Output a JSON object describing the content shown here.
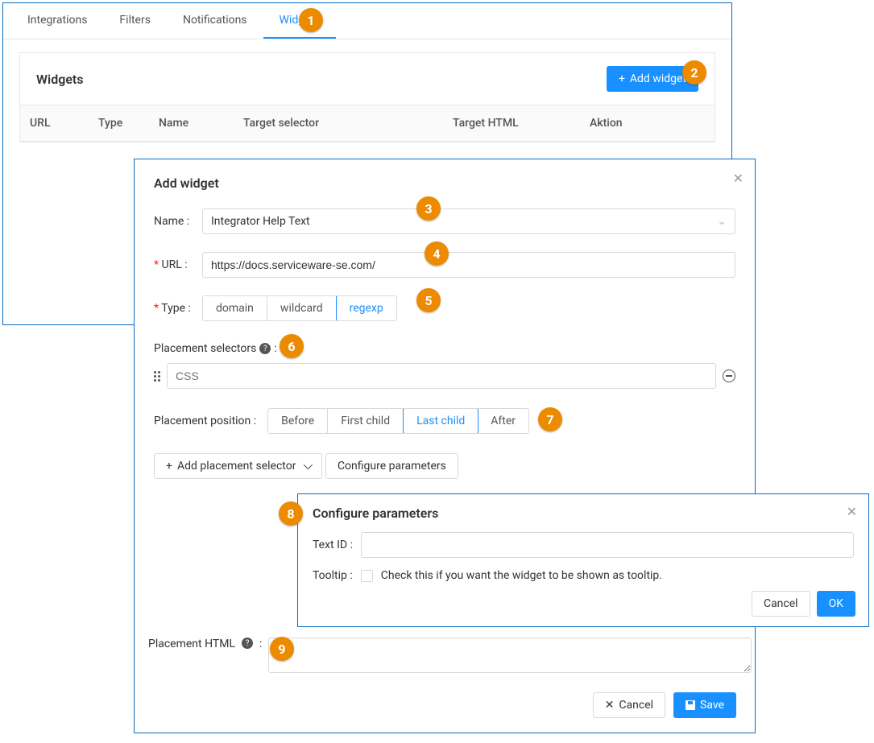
{
  "tabs": {
    "integrations": "Integrations",
    "filters": "Filters",
    "notifications": "Notifications",
    "widgets": "Widgets"
  },
  "widgets_panel": {
    "title": "Widgets",
    "add_btn": "Add widget",
    "columns": {
      "url": "URL",
      "type": "Type",
      "name": "Name",
      "target_selector": "Target  selector",
      "target_html": "Target HTML",
      "action": "Aktion"
    }
  },
  "add_widget_modal": {
    "title": "Add widget",
    "name_label": "Name :",
    "name_value": "Integrator Help Text",
    "url_label": "URL :",
    "url_value": "https://docs.serviceware-se.com/",
    "type_label": "Type :",
    "type_options": {
      "domain": "domain",
      "wildcard": "wildcard",
      "regexp": "regexp"
    },
    "placement_selectors_label": "Placement selectors",
    "css_placeholder": "CSS",
    "placement_position_label": "Placement position :",
    "position_options": {
      "before": "Before",
      "first_child": "First child",
      "last_child": "Last child",
      "after": "After"
    },
    "add_placement_btn": "Add placement selector",
    "configure_params_btn": "Configure parameters",
    "placement_html_label": "Placement HTML",
    "cancel_btn": "Cancel",
    "save_btn": "Save"
  },
  "config_params_modal": {
    "title": "Configure parameters",
    "text_id_label": "Text ID :",
    "tooltip_label": "Tooltip :",
    "tooltip_desc": "Check this if you want the widget to be shown as tooltip.",
    "cancel_btn": "Cancel",
    "ok_btn": "OK"
  },
  "callouts": {
    "c1": "1",
    "c2": "2",
    "c3": "3",
    "c4": "4",
    "c5": "5",
    "c6": "6",
    "c7": "7",
    "c8": "8",
    "c9": "9"
  }
}
